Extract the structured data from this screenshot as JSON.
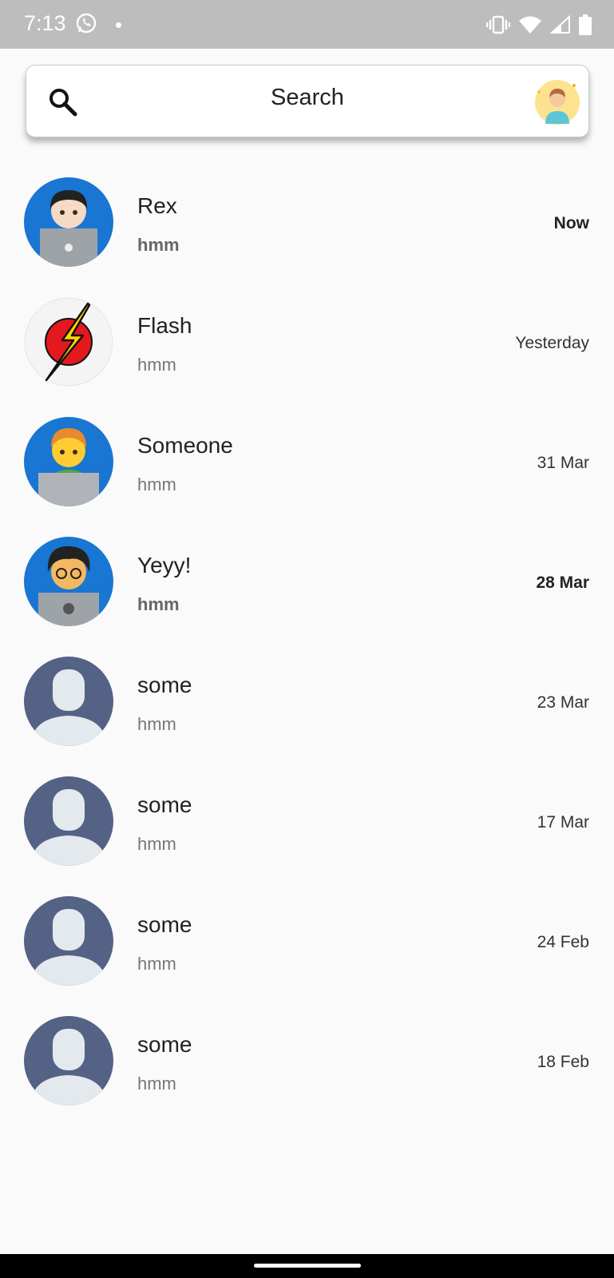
{
  "status_bar": {
    "time": "7:13",
    "icons": [
      "whatsapp-icon",
      "notification-dot",
      "vibrate-icon",
      "wifi-icon",
      "signal-icon",
      "battery-icon"
    ]
  },
  "search": {
    "label": "Search",
    "icon": "search-icon",
    "profile_icon": "profile-avatar"
  },
  "chats": [
    {
      "name": "Rex",
      "message": "hmm",
      "time": "Now",
      "unread": true,
      "avatar": "man-with-laptop"
    },
    {
      "name": "Flash",
      "message": "hmm",
      "time": "Yesterday",
      "unread": false,
      "avatar": "flash-logo"
    },
    {
      "name": "Someone",
      "message": "hmm",
      "time": "31 Mar",
      "unread": false,
      "avatar": "man-technologist"
    },
    {
      "name": "Yeyy!",
      "message": "hmm",
      "time": "28 Mar",
      "unread": true,
      "avatar": "nerd-technologist"
    },
    {
      "name": "some",
      "message": "hmm",
      "time": "23 Mar",
      "unread": false,
      "avatar": "default-person"
    },
    {
      "name": "some",
      "message": "hmm",
      "time": "17 Mar",
      "unread": false,
      "avatar": "default-person"
    },
    {
      "name": "some",
      "message": "hmm",
      "time": "24 Feb",
      "unread": false,
      "avatar": "default-person"
    },
    {
      "name": "some",
      "message": "hmm",
      "time": "18 Feb",
      "unread": false,
      "avatar": "default-person"
    }
  ],
  "colors": {
    "status_bar": "#bdbdbd",
    "avatar_blue": "#1976d2",
    "default_avatar_bg": "#546285",
    "background": "#fafafa"
  }
}
